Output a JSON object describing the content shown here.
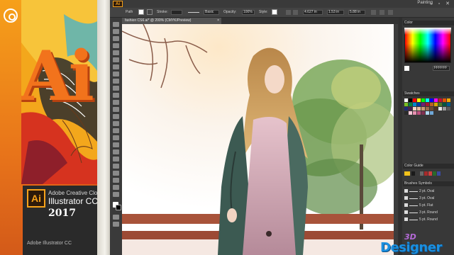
{
  "product_box": {
    "logo_letters": "Ai",
    "tile_letters": "Ai",
    "brand_line": "Adobe Creative Cloud",
    "product_line": "Illustrator CC",
    "year": "2017",
    "footer": "Adobe Illustrator CC",
    "colors": {
      "orange": "#f08a12",
      "yellow": "#f7b21a",
      "dark": "#2a2a2a"
    }
  },
  "app": {
    "menu_icon": "Ai",
    "workspace": "Painting",
    "window_buttons": "– ▫ ✕",
    "control_bar": {
      "path_label": "Path",
      "stroke_label": "Stroke:",
      "brush_value": "Basic",
      "opacity_label": "Opacity:",
      "opacity_value": "100%",
      "style_label": "Style:",
      "x_value": "4.627 in",
      "y_value": "1.53 in",
      "w_value": "5.88 in"
    },
    "document_tab": "fashion CS6.ai* @ 200% (CMYK/Preview)",
    "document_tab_close": "×",
    "panels": {
      "color_title": "Color",
      "color_hex": "FFFFFF",
      "swatches_title": "Swatches",
      "color_guide_title": "Color Guide",
      "brushes_tabs": "Brushes   Symbols",
      "brushes": [
        {
          "label": "2 pt. Oval"
        },
        {
          "label": "3 pt. Oval"
        },
        {
          "label": "5 pt. Flat"
        },
        {
          "label": "3 pt. Round"
        },
        {
          "label": "5 pt. Round"
        }
      ]
    }
  },
  "watermark": {
    "prefix": "3D",
    "text": "Designer"
  }
}
